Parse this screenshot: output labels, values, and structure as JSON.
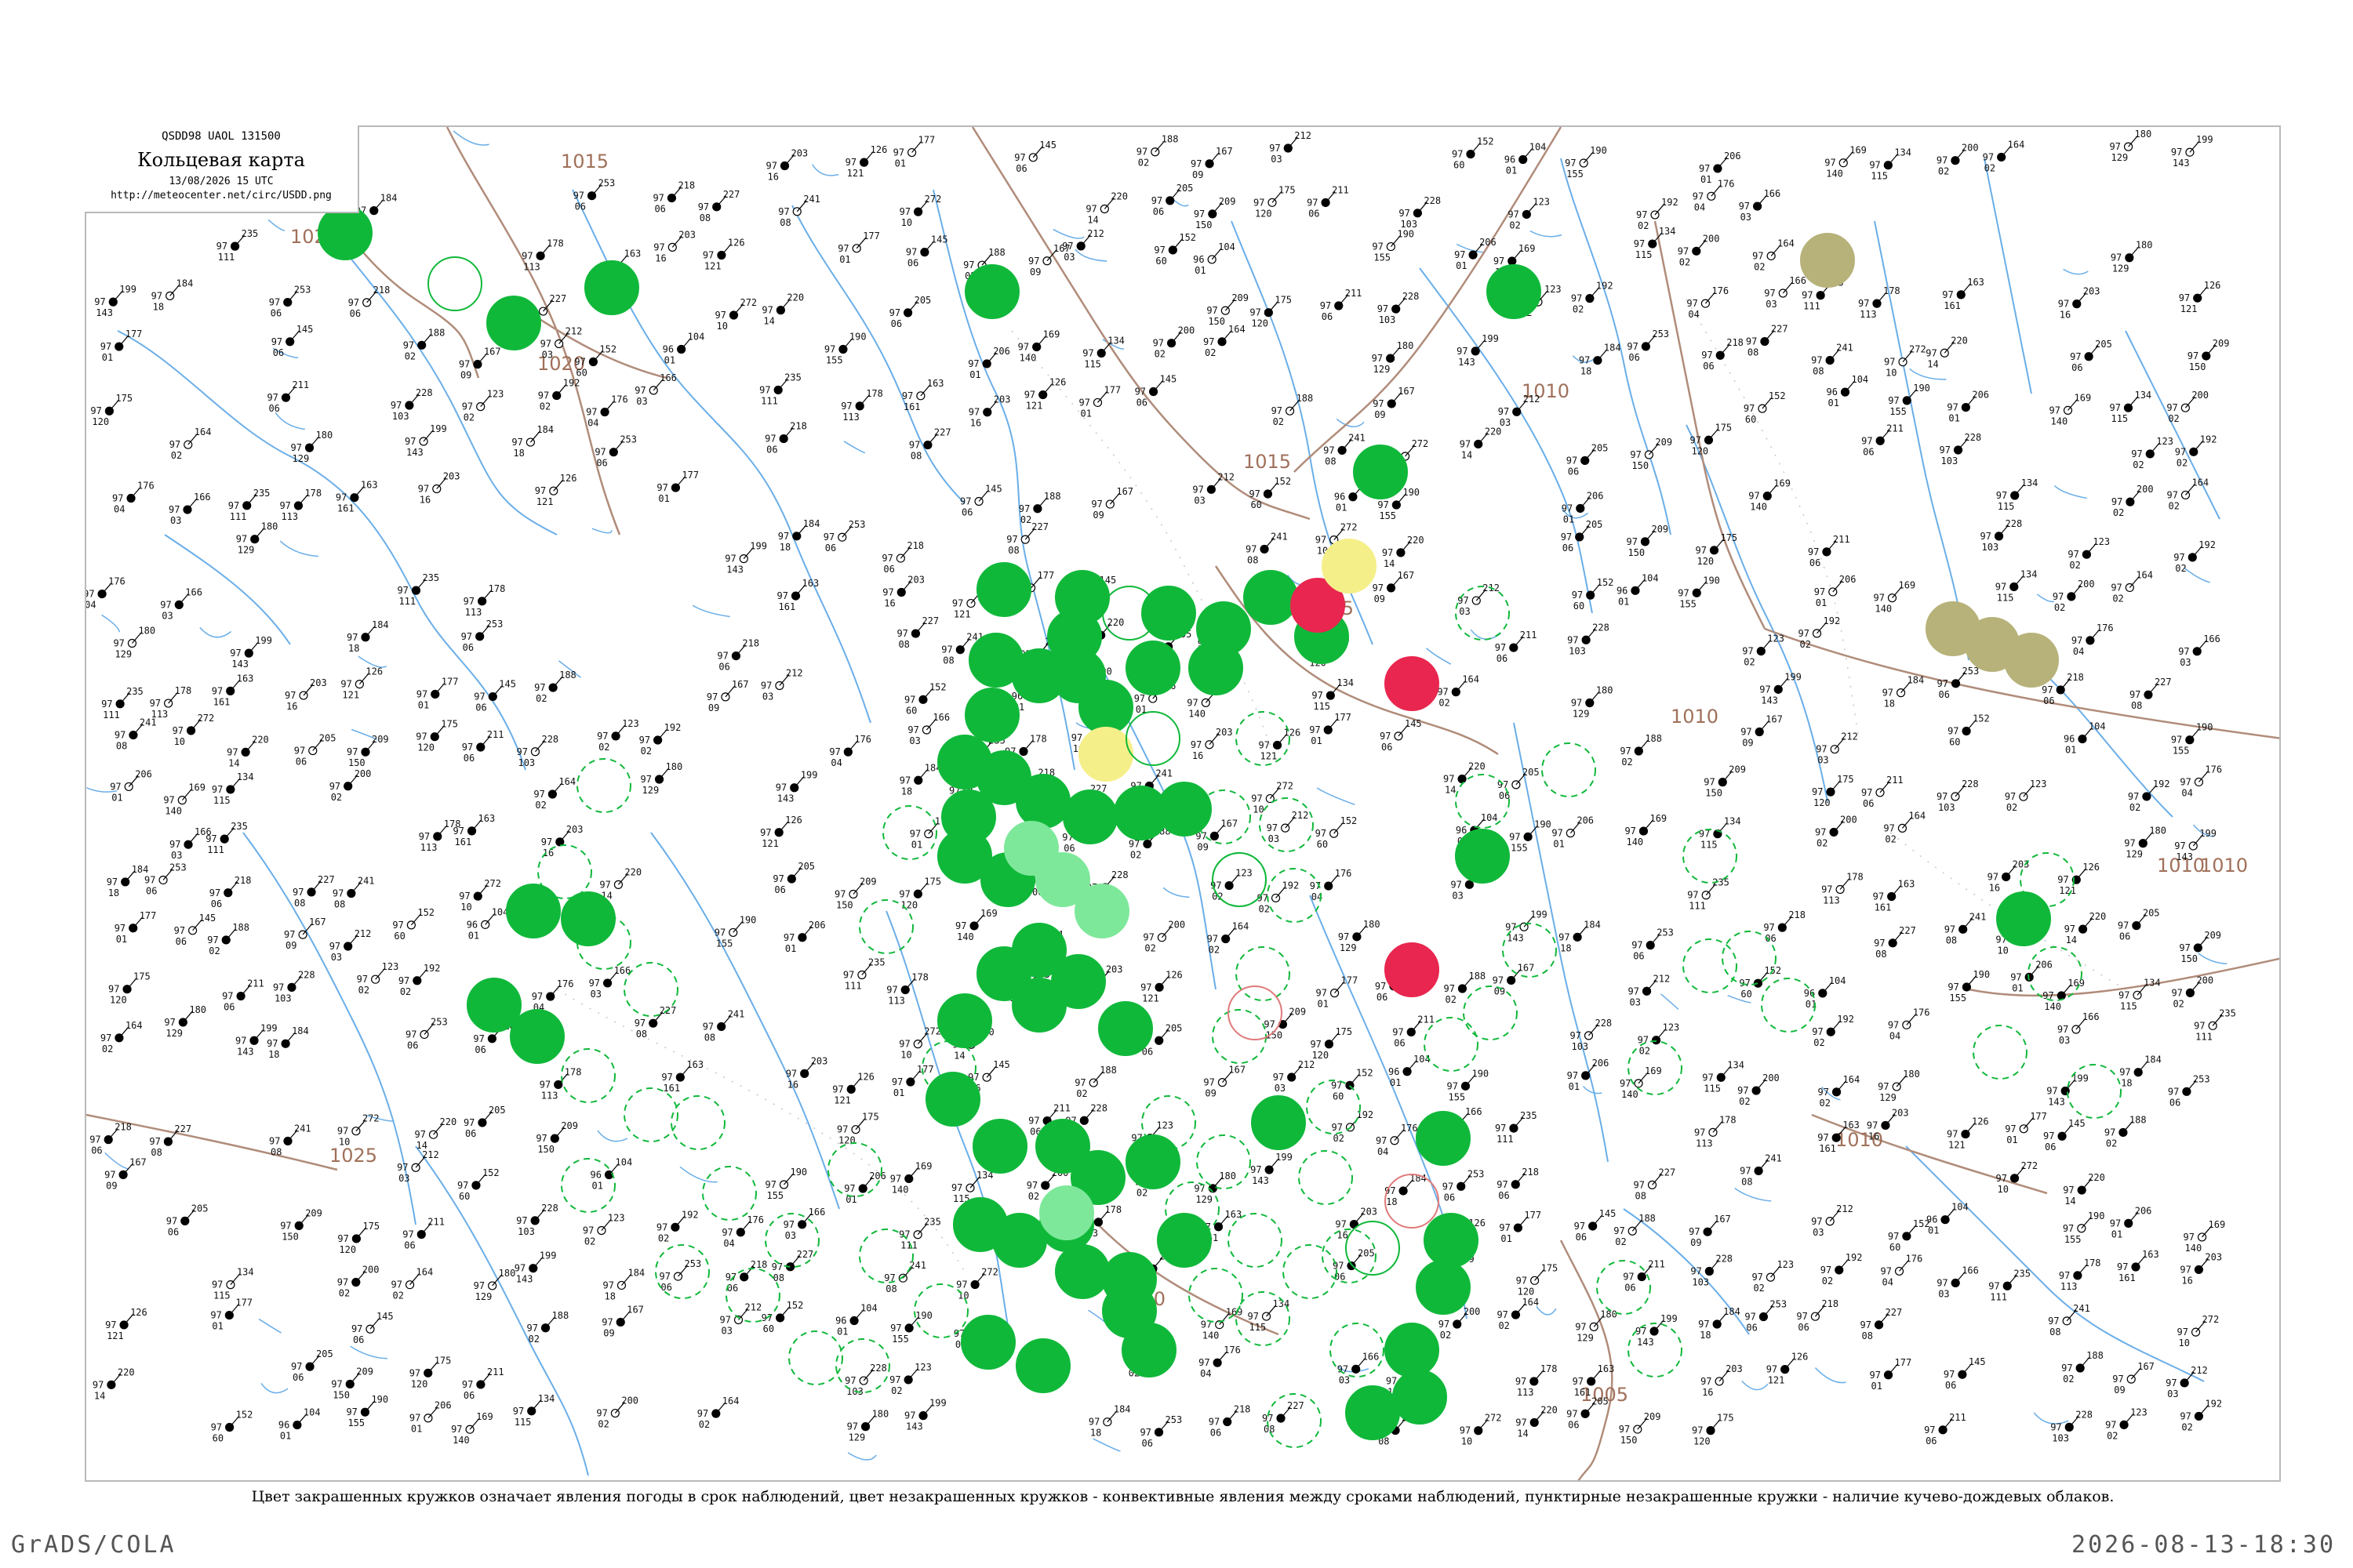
{
  "header": {
    "code": "QSDD98  UAOL  131500",
    "title": "Кольцевая карта",
    "time": "13/08/2026 15 UTC",
    "url": "http://meteocenter.net/circ/USDD.png"
  },
  "caption": "Цвет закрашенных кружков означает явления погоды в срок наблюдений, цвет незакрашенных кружков - конвективные явления между сроками наблюдений, пунктирные незакрашенные кружки - наличие кучево-дождевых облаков.",
  "footer": {
    "left": "GrADS/COLA",
    "right": "2026-08-13-18:30"
  },
  "colors": {
    "rain": "#10b83a",
    "shower_light": "#7ee89a",
    "thunder": "#e8264f",
    "haze": "#f5ef8a",
    "dust": "#b7b27a",
    "river": "#6aaee8",
    "isobar": "#b08c7a",
    "frame": "#b9b9b9"
  },
  "isobars": [
    {
      "label": "1015"
    },
    {
      "label": "1020"
    },
    {
      "label": "1020"
    },
    {
      "label": "1015"
    },
    {
      "label": "1010"
    },
    {
      "label": "1005"
    },
    {
      "label": "1010"
    },
    {
      "label": "1010"
    },
    {
      "label": "1025"
    },
    {
      "label": "1010"
    },
    {
      "label": "1010"
    },
    {
      "label": "1005"
    },
    {
      "label": "1010"
    }
  ],
  "stations_sample": [
    {
      "pressure": "203",
      "temp": "97",
      "dew": "16"
    },
    {
      "pressure": "126",
      "temp": "97",
      "dew": "121"
    },
    {
      "pressure": "177",
      "temp": "97",
      "dew": "01"
    },
    {
      "pressure": "145",
      "temp": "97",
      "dew": "06"
    },
    {
      "pressure": "188",
      "temp": "97",
      "dew": "02"
    },
    {
      "pressure": "167",
      "temp": "97",
      "dew": "09"
    },
    {
      "pressure": "212",
      "temp": "97",
      "dew": "03"
    },
    {
      "pressure": "152",
      "temp": "97",
      "dew": "60"
    },
    {
      "pressure": "104",
      "temp": "96",
      "dew": "01"
    },
    {
      "pressure": "190",
      "temp": "97",
      "dew": "155"
    },
    {
      "pressure": "206",
      "temp": "97",
      "dew": "01"
    },
    {
      "pressure": "169",
      "temp": "97",
      "dew": "140"
    },
    {
      "pressure": "134",
      "temp": "97",
      "dew": "115"
    },
    {
      "pressure": "200",
      "temp": "97",
      "dew": "02"
    },
    {
      "pressure": "164",
      "temp": "97",
      "dew": "02"
    },
    {
      "pressure": "180",
      "temp": "97",
      "dew": "129"
    },
    {
      "pressure": "199",
      "temp": "97",
      "dew": "143"
    },
    {
      "pressure": "184",
      "temp": "97",
      "dew": "18"
    },
    {
      "pressure": "253",
      "temp": "97",
      "dew": "06"
    },
    {
      "pressure": "218",
      "temp": "97",
      "dew": "06"
    },
    {
      "pressure": "227",
      "temp": "97",
      "dew": "08"
    },
    {
      "pressure": "241",
      "temp": "97",
      "dew": "08"
    },
    {
      "pressure": "272",
      "temp": "97",
      "dew": "10"
    },
    {
      "pressure": "220",
      "temp": "97",
      "dew": "14"
    },
    {
      "pressure": "205",
      "temp": "97",
      "dew": "06"
    },
    {
      "pressure": "209",
      "temp": "97",
      "dew": "150"
    },
    {
      "pressure": "175",
      "temp": "97",
      "dew": "120"
    },
    {
      "pressure": "211",
      "temp": "97",
      "dew": "06"
    },
    {
      "pressure": "228",
      "temp": "97",
      "dew": "103"
    },
    {
      "pressure": "123",
      "temp": "97",
      "dew": "02"
    },
    {
      "pressure": "192",
      "temp": "97",
      "dew": "02"
    },
    {
      "pressure": "176",
      "temp": "97",
      "dew": "04"
    },
    {
      "pressure": "166",
      "temp": "97",
      "dew": "03"
    },
    {
      "pressure": "235",
      "temp": "97",
      "dew": "111"
    },
    {
      "pressure": "178",
      "temp": "97",
      "dew": "113"
    },
    {
      "pressure": "163",
      "temp": "97",
      "dew": "161"
    }
  ]
}
